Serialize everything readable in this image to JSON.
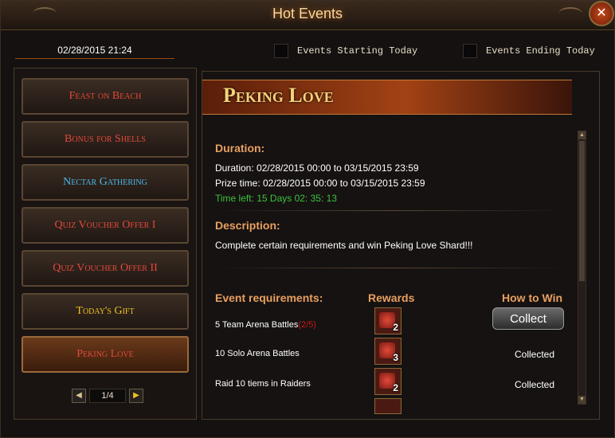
{
  "window": {
    "title": "Hot Events",
    "close_icon": "close-icon"
  },
  "datetime": "02/28/2015 21:24",
  "filters": [
    {
      "label": "Events Starting Today",
      "checked": false
    },
    {
      "label": "Events Ending Today",
      "checked": false
    }
  ],
  "events": [
    {
      "label": "Feast on Beach",
      "color": "#e2483a"
    },
    {
      "label": "Bonus for Shells",
      "color": "#e2483a"
    },
    {
      "label": "Nectar Gathering",
      "color": "#4ab8e8"
    },
    {
      "label": "Quiz Voucher Offer I",
      "color": "#e2483a"
    },
    {
      "label": "Quiz Voucher Offer II",
      "color": "#e2483a"
    },
    {
      "label": "Today's Gift",
      "color": "#f0c020"
    },
    {
      "label": "Peking Love",
      "color": "#e2483a",
      "active": true
    }
  ],
  "pager": {
    "page": "1/4"
  },
  "detail": {
    "title": "Peking Love",
    "duration_head": "Duration:",
    "duration": "Duration: 02/28/2015 00:00 to 03/15/2015 23:59",
    "prize_time": "Prize time: 02/28/2015 00:00 to 03/15/2015 23:59",
    "time_left": "Time left: 15 Days  02: 35: 13",
    "description_head": "Description:",
    "description": "Complete certain requirements and win Peking Love Shard!!!",
    "req_head": "Event requirements:",
    "rewards_head": "Rewards",
    "how_head": "How to Win",
    "requirements": [
      {
        "text": "5 Team Arena Battles",
        "progress": "(2/5)",
        "reward_count": "2",
        "action": "Collect"
      },
      {
        "text": "10 Solo Arena Battles",
        "progress": "",
        "reward_count": "3",
        "action": "Collected"
      },
      {
        "text": "Raid 10 tiems in Raiders",
        "progress": "",
        "reward_count": "2",
        "action": "Collected"
      }
    ]
  }
}
